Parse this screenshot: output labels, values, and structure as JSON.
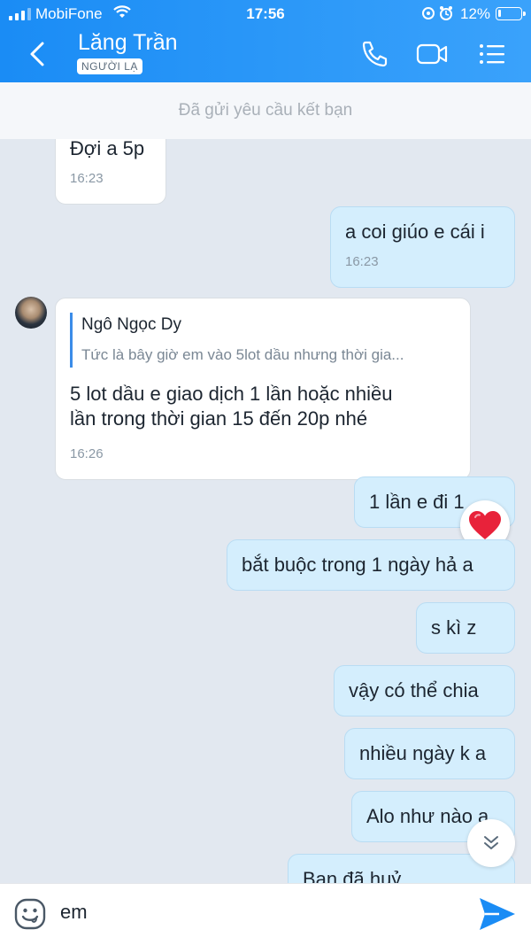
{
  "status": {
    "carrier": "MobiFone",
    "time": "17:56",
    "battery": "12%",
    "battery_level": 0.12
  },
  "header": {
    "title": "Lăng Trần",
    "badge": "NGƯỜI LẠ"
  },
  "banner": "Đã gửi yêu cầu kết bạn",
  "messages": [
    {
      "direction": "in",
      "text": "Đợi a 5p",
      "time": "16:23"
    },
    {
      "direction": "out",
      "text": "a coi giúo e cái i",
      "time": "16:23"
    },
    {
      "direction": "in",
      "quote_name": "Ngô Ngọc Dy",
      "quote_text": "Tức là bây giờ em vào 5lot dầu nhưng thời gia...",
      "text_line1": "5 lot dầu e giao dịch 1 lần hoặc nhiều",
      "text_line2": "lần trong thời gian 15 đến 20p nhé",
      "time": "16:26"
    },
    {
      "direction": "out",
      "text": "1 lần e đi 1"
    },
    {
      "direction": "out",
      "text": "bắt buộc trong 1 ngày hả a"
    },
    {
      "direction": "out",
      "text": "s kì z"
    },
    {
      "direction": "out",
      "text": "vậy có thể chia"
    },
    {
      "direction": "out",
      "text": "nhiều ngày k a"
    },
    {
      "direction": "out",
      "text": "Alo như nào a"
    },
    {
      "direction": "out",
      "text": "Bạn đã huỷ"
    }
  ],
  "composer": {
    "value": "em"
  },
  "icons": {
    "back": "chevron-left-icon",
    "call": "phone-icon",
    "video": "video-camera-icon",
    "menu": "list-menu-icon",
    "reaction": "heart-icon",
    "scroll": "double-chevron-down-icon",
    "emoji": "emoji-icon",
    "send": "send-icon"
  },
  "colors": {
    "header": "#1a8cf5",
    "outgoing_bubble": "#d4eefd",
    "incoming_bubble": "#ffffff",
    "send": "#1a8cf5",
    "heart": "#e8223a"
  }
}
